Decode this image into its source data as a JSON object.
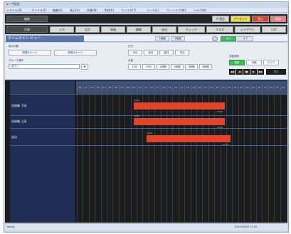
{
  "window": {
    "title": "ユーザ設定"
  },
  "menu": [
    "システム(S)",
    "ファイル(F)",
    "編集(E)",
    "表示(V)",
    "作業(W)",
    "予約(R)",
    "フィルタ(T)",
    "ツール(L)",
    "ウィンドウ(W)",
    "ヘルプ(H)"
  ],
  "row1": {
    "indicator": "編集",
    "btn_a": "A 設定",
    "btn_b": "プリセット",
    "btn_c": "停止",
    "btn_d": "削除"
  },
  "row2": {
    "mode": "作業",
    "buttons": [
      "入力",
      "出力",
      "録画",
      "編集",
      "送出",
      "チェック",
      "マスタ",
      "レイアウト",
      "ログ"
    ]
  },
  "tabs": {
    "active": "タイムライン ビュー",
    "btn1": "1画面",
    "btn2": "2画面",
    "toggle": "オン",
    "btn3": "オフ"
  },
  "controls": {
    "label_display": "表示切替",
    "btn_timeline": "時間スケール",
    "btn_detail": "詳細スケール",
    "label_group": "グループ選択",
    "group_value": "(全て)",
    "label_date": "日付",
    "date_btns": [
      "今日",
      "前日",
      "翌日",
      "本日"
    ],
    "label_scale": "目盛",
    "scale_btns": [
      "15分",
      "30分",
      "1時間",
      "2時間",
      "3時間",
      "6時間"
    ],
    "label_auto": "自動更新",
    "btn_auto": "更新",
    "btn_manual": "手動",
    "btn_clear": "クリア",
    "transport": [
      "◀◀",
      "◀",
      "■",
      "▶",
      "▶▶"
    ],
    "btn_now": "現在"
  },
  "gantt": {
    "header_ticks": [
      "00",
      "01",
      "02",
      "03",
      "04",
      "05",
      "06",
      "07",
      "08",
      "09",
      "10",
      "11",
      "12",
      "13",
      "14",
      "15",
      "16",
      "17",
      "18",
      "19",
      "20",
      "21",
      "22",
      "23",
      "24",
      "25",
      "26",
      "27",
      "28",
      "29",
      "30",
      "31",
      "32",
      "33",
      "34"
    ],
    "rows": [
      {
        "name": "収録機 下段",
        "start": "10:30",
        "end": "16:50"
      },
      {
        "name": "収録機 上段",
        "start": "10:30",
        "end": "16:50"
      },
      {
        "name": "送出",
        "start": "11:20",
        "end": "17:10"
      }
    ]
  },
  "status": {
    "left": "Ready",
    "right": "2012/09/25 17:10"
  }
}
